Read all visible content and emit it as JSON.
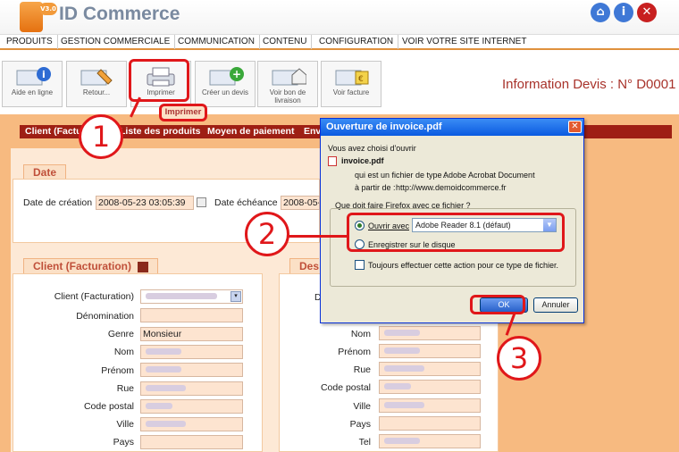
{
  "header": {
    "logo_badge": "V3.0",
    "brand": "ID Commerce"
  },
  "menu": [
    "PRODUITS",
    "GESTION COMMERCIALE",
    "COMMUNICATION",
    "CONTENU",
    "CONFIGURATION",
    "VOIR VOTRE SITE INTERNET"
  ],
  "toolbar": [
    {
      "label": "Aide en ligne",
      "icon": "help-icon"
    },
    {
      "label": "Retour...",
      "icon": "back-document-icon"
    },
    {
      "label": "Imprimer",
      "icon": "printer-icon"
    },
    {
      "label": "Créer un devis",
      "icon": "create-quote-icon"
    },
    {
      "label": "Voir bon de livraison",
      "icon": "delivery-note-icon"
    },
    {
      "label": "Voir facture",
      "icon": "invoice-icon"
    }
  ],
  "tooltip": "Imprimer",
  "page_title": "Information Devis : N° D0001",
  "tabs": [
    "Client (Factu",
    "Liste des produits",
    "Moyen de paiement",
    "Env"
  ],
  "date_section": {
    "title": "Date",
    "creation_label": "Date de création",
    "creation_value": "2008-05-23 03:05:39",
    "echeance_label": "Date échéance",
    "echeance_value": "2008-05-2"
  },
  "client_section": {
    "title": "Client (Facturation)",
    "fields": [
      {
        "label": "Client (Facturation)",
        "value": ""
      },
      {
        "label": "Dénomination",
        "value": ""
      },
      {
        "label": "Genre",
        "value": "Monsieur"
      },
      {
        "label": "Nom",
        "value": ""
      },
      {
        "label": "Prénom",
        "value": ""
      },
      {
        "label": "Rue",
        "value": ""
      },
      {
        "label": "Code postal",
        "value": ""
      },
      {
        "label": "Ville",
        "value": ""
      },
      {
        "label": "Pays",
        "value": ""
      }
    ]
  },
  "right_section": {
    "title": "Des",
    "fields": [
      {
        "label": "D",
        "value": ""
      },
      {
        "label": "Nom",
        "value": ""
      },
      {
        "label": "Prénom",
        "value": ""
      },
      {
        "label": "Rue",
        "value": ""
      },
      {
        "label": "Code postal",
        "value": ""
      },
      {
        "label": "Ville",
        "value": ""
      },
      {
        "label": "Pays",
        "value": ""
      },
      {
        "label": "Tel",
        "value": ""
      }
    ]
  },
  "dialog": {
    "title": "Ouverture de invoice.pdf",
    "intro": "Vous avez choisi d'ouvrir",
    "filename": "invoice.pdf",
    "type_label": "qui est un fichier de type :",
    "type_value": "Adobe Acrobat Document",
    "from_label": "à partir de :",
    "from_value": "http://www.demoidcommerce.fr",
    "question": "Que doit faire Firefox avec ce fichier ?",
    "open_with_label": "Ouvrir avec",
    "open_with_value": "Adobe Reader 8.1 (défaut)",
    "save_label": "Enregistrer sur le disque",
    "always_label": "Toujours effectuer cette action pour ce type de fichier.",
    "ok_label": "OK",
    "cancel_label": "Annuler"
  },
  "steps": [
    "1",
    "2",
    "3"
  ],
  "colors": {
    "accent_red": "#e0171a",
    "tab_bar": "#9e1f14",
    "orange_bg": "#f7ba80",
    "title_red": "#a8322a"
  }
}
